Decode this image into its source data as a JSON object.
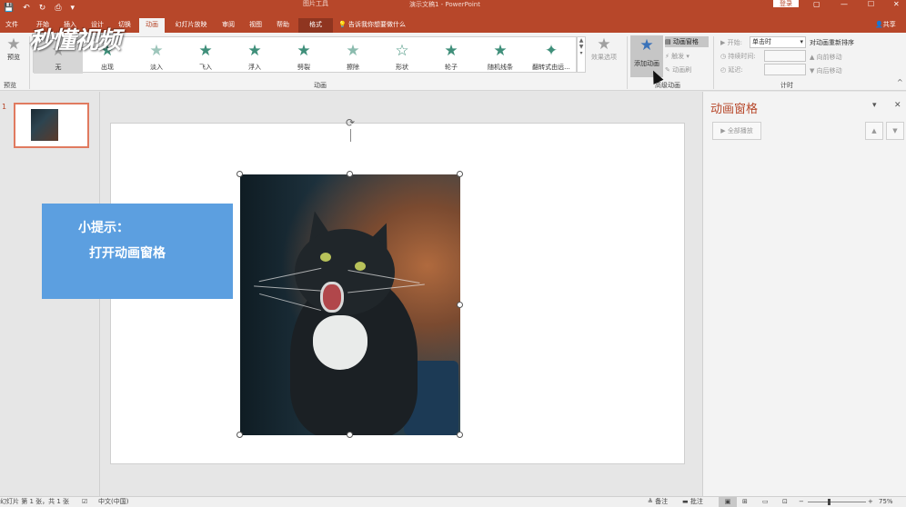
{
  "titlebar": {
    "context_title": "图片工具",
    "doc_title": "演示文稿1 - PowerPoint",
    "login": "登录",
    "qat": [
      "💾",
      "↶",
      "↻",
      "⎙",
      "▾"
    ]
  },
  "tabs": [
    "文件",
    "开始",
    "插入",
    "设计",
    "切换",
    "动画",
    "幻灯片放映",
    "审阅",
    "视图",
    "帮助",
    "格式"
  ],
  "active_tab": "动画",
  "tellme": "告诉我你想要做什么",
  "share": "共享",
  "ribbon": {
    "preview_label": "预览",
    "preview_group": "预览",
    "animations": [
      "无",
      "出现",
      "淡入",
      "飞入",
      "浮入",
      "劈裂",
      "擦除",
      "形状",
      "轮子",
      "随机线条",
      "翻转式由远..."
    ],
    "effect_options": "效果选项",
    "animation_group": "动画",
    "add_animation": "添加动画",
    "anim_pane_btn": "动画窗格",
    "trigger": "触发",
    "anim_painter": "动画刷",
    "advanced_group": "高级动画",
    "start_label": "开始:",
    "start_value": "单击时",
    "duration_label": "持续时间:",
    "delay_label": "延迟:",
    "reorder_title": "对动画重新排序",
    "move_earlier": "向前移动",
    "move_later": "向后移动",
    "timing_group": "计时"
  },
  "thumbs": {
    "slide_number": "1"
  },
  "slide": {
    "tip_line1": "小提示：",
    "tip_line2": "打开动画窗格"
  },
  "anim_pane": {
    "title": "动画窗格",
    "play_all": "全部播放"
  },
  "statusbar": {
    "slide_info": "幻灯片 第 1 张，共 1 张",
    "language": "中文(中国)",
    "notes": "备注",
    "comments": "批注",
    "zoom": "75%"
  },
  "watermark": "秒懂视频"
}
